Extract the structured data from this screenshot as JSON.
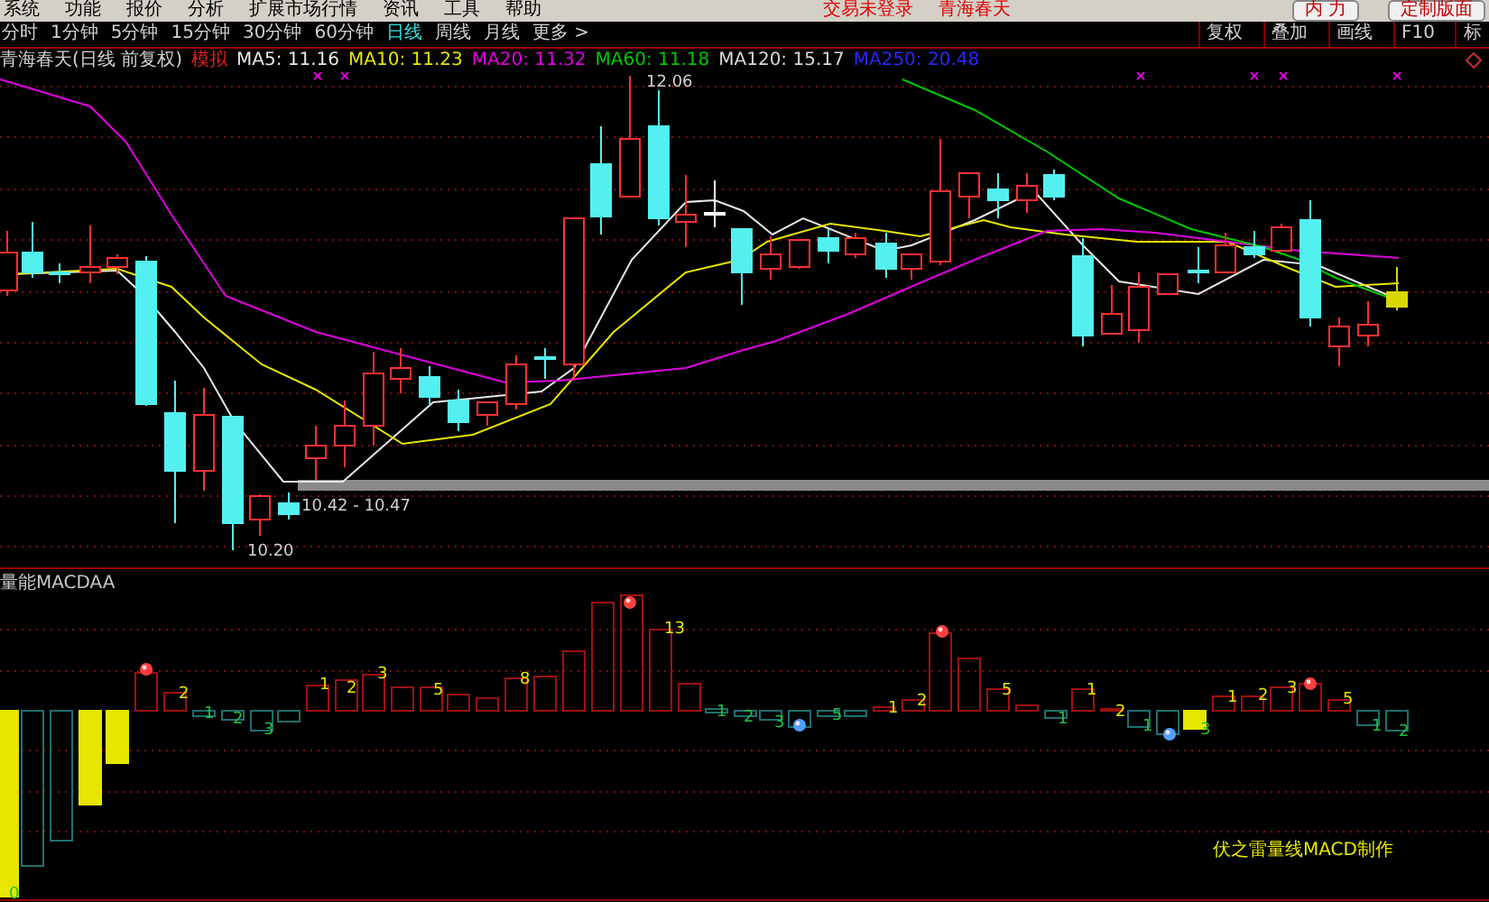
{
  "menu_bar": {
    "items": [
      "系统",
      "功能",
      "报价",
      "分析",
      "扩展市场行情",
      "资讯",
      "工具",
      "帮助"
    ],
    "notices": [
      "交易未登录",
      "青海春天"
    ],
    "buttons": [
      "内 力",
      "定制版面"
    ]
  },
  "period_tabs": [
    {
      "label": "分时",
      "selected": false
    },
    {
      "label": "1分钟",
      "selected": false
    },
    {
      "label": "5分钟",
      "selected": false
    },
    {
      "label": "15分钟",
      "selected": false
    },
    {
      "label": "30分钟",
      "selected": false
    },
    {
      "label": "60分钟",
      "selected": false
    },
    {
      "label": "日线",
      "selected": true
    },
    {
      "label": "周线",
      "selected": false
    },
    {
      "label": "月线",
      "selected": false
    },
    {
      "label": "更多 >",
      "selected": false
    }
  ],
  "tool_buttons": [
    "复权",
    "叠加",
    "画线",
    "F10",
    "标"
  ],
  "chart_header": {
    "title": "青海春天(日线 前复权)",
    "mode": "模拟",
    "averages": [
      {
        "label": "MA5: 11.16",
        "color": "#e6e6e6"
      },
      {
        "label": "MA10: 11.23",
        "color": "#e6e600"
      },
      {
        "label": "MA20: 11.32",
        "color": "#e000e0"
      },
      {
        "label": "MA60: 11.18",
        "color": "#00c800"
      },
      {
        "label": "MA120: 15.17",
        "color": "#d8d8d8"
      },
      {
        "label": "MA250: 20.48",
        "color": "#2828ff"
      }
    ]
  },
  "price_chart": {
    "high_label": "12.06",
    "range_label": "10.42 - 10.47",
    "low_label": "10.20"
  },
  "indicator": {
    "title": "量能MACDAA",
    "credit": "伏之雷量线MACD制作",
    "histogram_labels": [
      {
        "text": "0",
        "kind": "down"
      },
      {
        "text": "2",
        "kind": "up"
      },
      {
        "text": "1",
        "kind": "down"
      },
      {
        "text": "2",
        "kind": "down"
      },
      {
        "text": "3",
        "kind": "down"
      },
      {
        "text": "1",
        "kind": "up"
      },
      {
        "text": "2",
        "kind": "up"
      },
      {
        "text": "3",
        "kind": "up"
      },
      {
        "text": "5",
        "kind": "up"
      },
      {
        "text": "8",
        "kind": "up"
      },
      {
        "text": "13",
        "kind": "up"
      },
      {
        "text": "1",
        "kind": "down"
      },
      {
        "text": "2",
        "kind": "down"
      },
      {
        "text": "3",
        "kind": "down"
      },
      {
        "text": "5",
        "kind": "down"
      },
      {
        "text": "1",
        "kind": "up"
      },
      {
        "text": "2",
        "kind": "up"
      },
      {
        "text": "5",
        "kind": "up"
      },
      {
        "text": "1",
        "kind": "down"
      },
      {
        "text": "1",
        "kind": "up"
      },
      {
        "text": "2",
        "kind": "up"
      },
      {
        "text": "1",
        "kind": "down"
      },
      {
        "text": "3",
        "kind": "down"
      },
      {
        "text": "1",
        "kind": "up"
      },
      {
        "text": "2",
        "kind": "up"
      },
      {
        "text": "3",
        "kind": "up"
      },
      {
        "text": "5",
        "kind": "up"
      },
      {
        "text": "1",
        "kind": "down"
      },
      {
        "text": "2",
        "kind": "down"
      }
    ]
  }
}
